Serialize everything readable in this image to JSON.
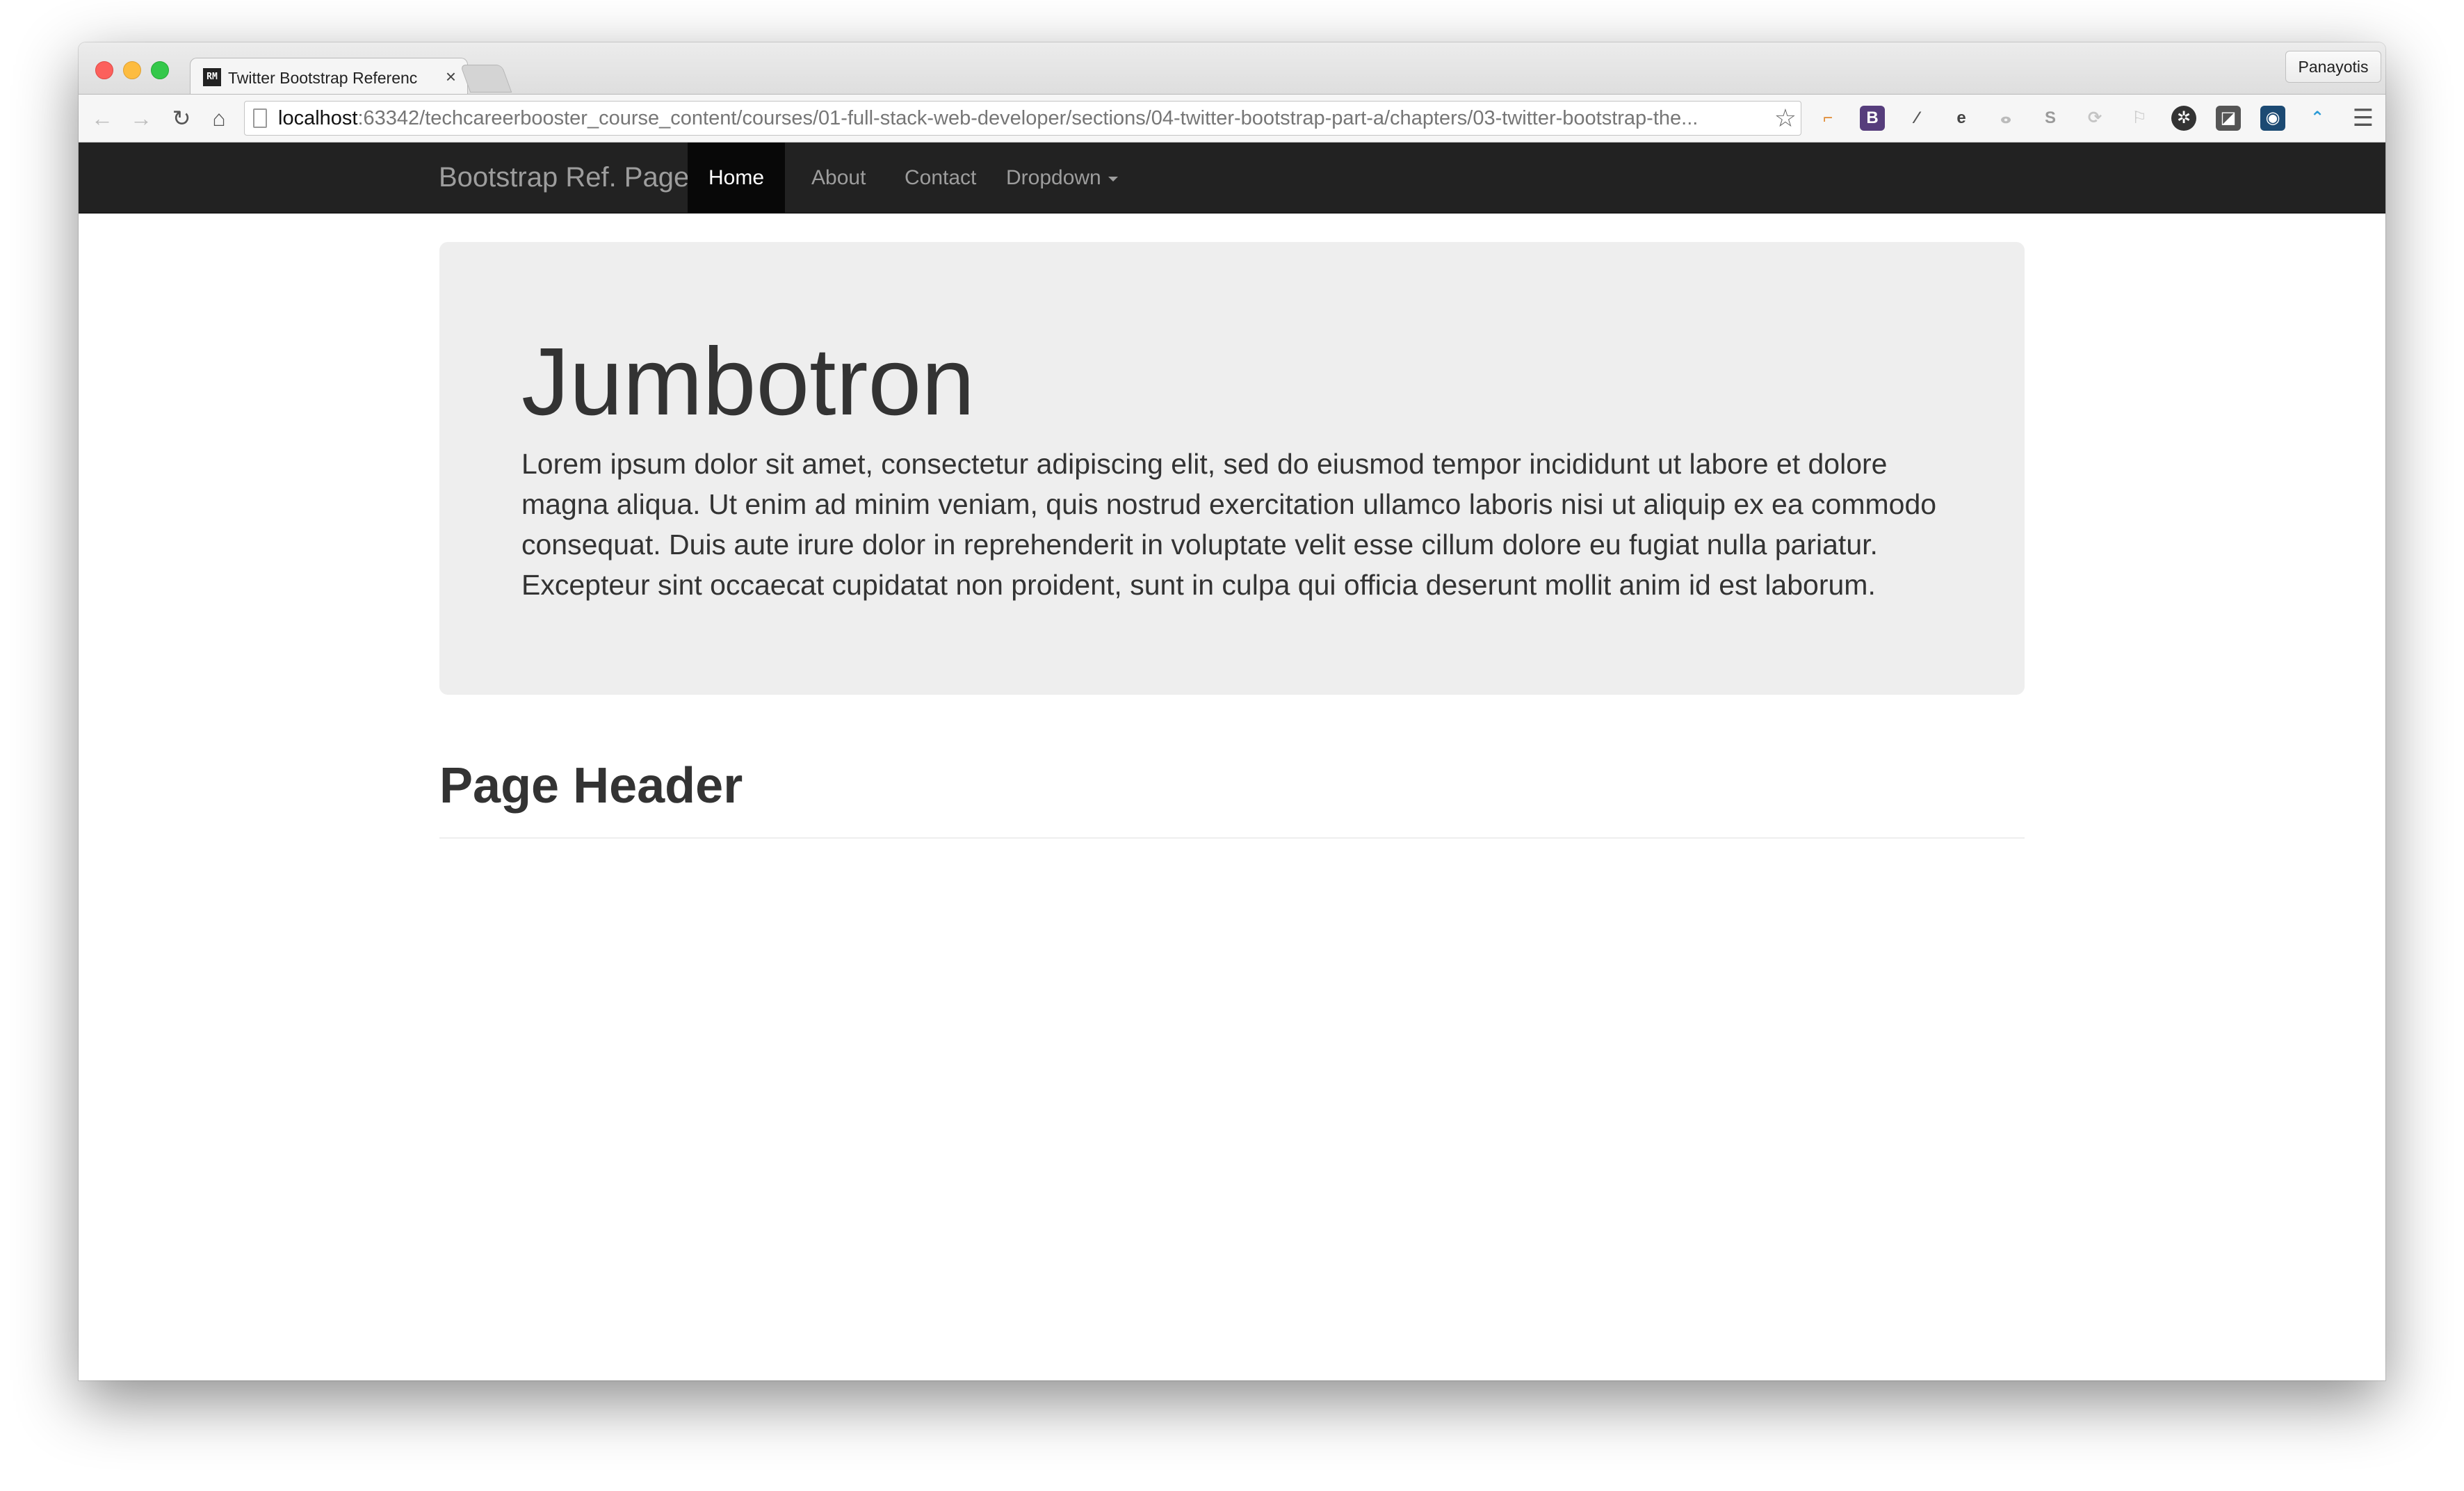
{
  "browser": {
    "tab_title": "Twitter Bootstrap Referenc",
    "tab_favicon_text": "RM",
    "tab_close": "×",
    "profile_name": "Panayotis",
    "url_host": "localhost",
    "url_rest": ":63342/techcareerbooster_course_content/courses/01-full-stack-web-developer/sections/04-twitter-bootstrap-part-a/chapters/03-twitter-bootstrap-the...",
    "extensions": [
      {
        "name": "bookmark-ext-icon",
        "glyph": "⌐",
        "color": "#e08a32"
      },
      {
        "name": "bootstrap-ext-icon",
        "glyph": "B",
        "color": "#563d7c"
      },
      {
        "name": "eyedropper-ext-icon",
        "glyph": "⁄",
        "color": "#555555"
      },
      {
        "name": "evernote-ext-icon",
        "glyph": "e",
        "color": "#444444"
      },
      {
        "name": "tree-ext-icon",
        "glyph": "ⴰ",
        "color": "#bbbbbb"
      },
      {
        "name": "skype-ext-icon",
        "glyph": "S",
        "color": "#9a9a9a"
      },
      {
        "name": "sync-ext-icon",
        "glyph": "⟳",
        "color": "#c4c4c4"
      },
      {
        "name": "flag-ext-icon",
        "glyph": "⚐",
        "color": "#c4c4c4"
      },
      {
        "name": "settings-ext-icon",
        "glyph": "✲",
        "color": "#333333"
      },
      {
        "name": "note-ext-icon",
        "glyph": "◪",
        "color": "#555555"
      },
      {
        "name": "lock-ext-icon",
        "glyph": "◉",
        "color": "#1c4a73"
      },
      {
        "name": "analytics-ext-icon",
        "glyph": "⌃",
        "color": "#2a9ad6"
      }
    ]
  },
  "navbar": {
    "brand": "Bootstrap Ref. Page",
    "items": [
      {
        "label": "Home",
        "active": true
      },
      {
        "label": "About",
        "active": false
      },
      {
        "label": "Contact",
        "active": false
      },
      {
        "label": "Dropdown",
        "active": false
      }
    ]
  },
  "jumbotron": {
    "title": "Jumbotron",
    "text": "Lorem ipsum dolor sit amet, consectetur adipiscing elit, sed do eiusmod tempor incididunt ut labore et dolore magna aliqua. Ut enim ad minim veniam, quis nostrud exercitation ullamco laboris nisi ut aliquip ex ea commodo consequat. Duis aute irure dolor in reprehenderit in voluptate velit esse cillum dolore eu fugiat nulla pariatur. Excepteur sint occaecat cupidatat non proident, sunt in culpa qui officia deserunt mollit anim id est laborum."
  },
  "page_header": {
    "title": "Page Header"
  }
}
